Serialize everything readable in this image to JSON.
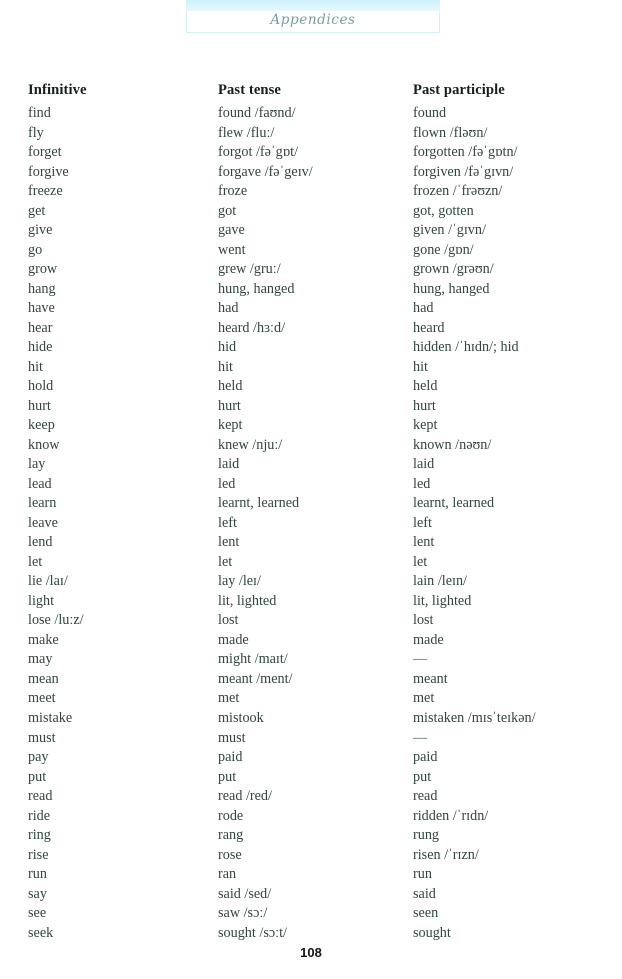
{
  "header": {
    "running_head": "Appendices"
  },
  "table": {
    "columns": [
      "Infinitive",
      "Past tense",
      "Past participle"
    ],
    "rows": [
      [
        "find",
        "found /faʊnd/",
        "found"
      ],
      [
        "fly",
        "flew /fluː/",
        "flown /fləʊn/"
      ],
      [
        "forget",
        "forgot /fəˈgɒt/",
        "forgotten /fəˈgɒtn/"
      ],
      [
        "forgive",
        "forgave /fəˈgeɪv/",
        "forgiven /fəˈgɪvn/"
      ],
      [
        "freeze",
        "froze",
        "frozen /ˈfrəʊzn/"
      ],
      [
        "get",
        "got",
        "got, gotten"
      ],
      [
        "give",
        "gave",
        "given /ˈgɪvn/"
      ],
      [
        "go",
        "went",
        "gone /gɒn/"
      ],
      [
        "grow",
        "grew /gruː/",
        "grown /grəʊn/"
      ],
      [
        "hang",
        "hung, hanged",
        "hung, hanged"
      ],
      [
        "have",
        "had",
        "had"
      ],
      [
        "hear",
        "heard /hɜːd/",
        "heard"
      ],
      [
        "hide",
        "hid",
        "hidden /ˈhɪdn/; hid"
      ],
      [
        "hit",
        "hit",
        "hit"
      ],
      [
        "hold",
        "held",
        "held"
      ],
      [
        "hurt",
        "hurt",
        "hurt"
      ],
      [
        "keep",
        "kept",
        "kept"
      ],
      [
        "know",
        "knew /njuː/",
        "known /nəʊn/"
      ],
      [
        "lay",
        "laid",
        "laid"
      ],
      [
        "lead",
        "led",
        "led"
      ],
      [
        "learn",
        "learnt, learned",
        "learnt, learned"
      ],
      [
        "leave",
        "left",
        "left"
      ],
      [
        "lend",
        "lent",
        "lent"
      ],
      [
        "let",
        "let",
        "let"
      ],
      [
        "lie /laɪ/",
        "lay /leɪ/",
        "lain /leɪn/"
      ],
      [
        "light",
        "lit, lighted",
        "lit, lighted"
      ],
      [
        "lose /luːz/",
        "lost",
        "lost"
      ],
      [
        "make",
        "made",
        "made"
      ],
      [
        "may",
        "might /maɪt/",
        "—"
      ],
      [
        "mean",
        "meant /ment/",
        "meant"
      ],
      [
        "meet",
        "met",
        "met"
      ],
      [
        "mistake",
        "mistook",
        "mistaken /mɪsˈteɪkən/"
      ],
      [
        "must",
        "must",
        "—"
      ],
      [
        "pay",
        "paid",
        "paid"
      ],
      [
        "put",
        "put",
        "put"
      ],
      [
        "read",
        "read /red/",
        "read"
      ],
      [
        "ride",
        "rode",
        "ridden /ˈrɪdn/"
      ],
      [
        "ring",
        "rang",
        "rung"
      ],
      [
        "rise",
        "rose",
        "risen /ˈrɪzn/"
      ],
      [
        "run",
        "ran",
        "run"
      ],
      [
        "say",
        "said /sed/",
        "said"
      ],
      [
        "see",
        "saw /sɔː/",
        "seen"
      ],
      [
        "seek",
        "sought /sɔːt/",
        "sought"
      ]
    ]
  },
  "footer": {
    "page_number": "108"
  },
  "colors": {
    "banner_strip": "#c9effa",
    "banner_title": "#7d9aa0",
    "body_text": "#32453e",
    "heading_text": "#13211c"
  }
}
